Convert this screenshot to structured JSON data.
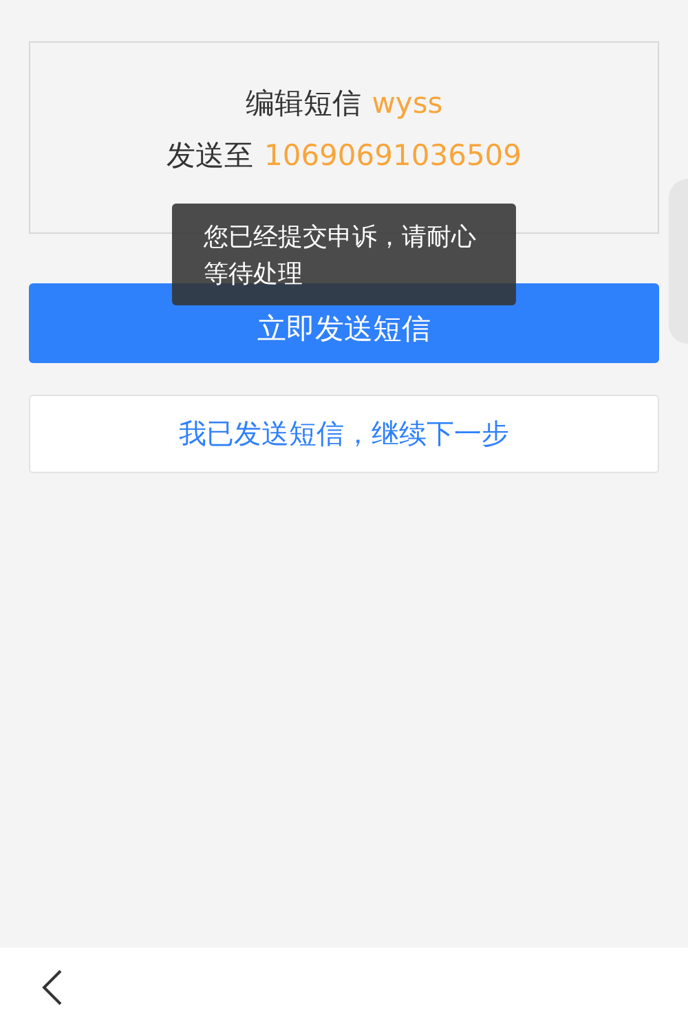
{
  "sms_card": {
    "edit_label": "编辑短信",
    "edit_code": "wyss",
    "send_label": "发送至",
    "send_number": "10690691036509"
  },
  "send_button": {
    "label": "立即发送短信"
  },
  "continue_button": {
    "label": "我已发送短信，继续下一步"
  },
  "toast": {
    "message": "您已经提交申诉，请耐心等待处理"
  }
}
